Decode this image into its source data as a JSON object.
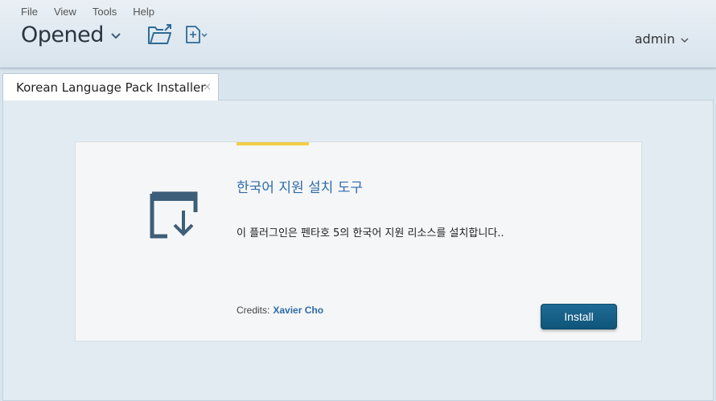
{
  "menu": {
    "items": [
      "File",
      "View",
      "Tools",
      "Help"
    ]
  },
  "perspective": {
    "label": "Opened",
    "icon": "chevron-down-icon"
  },
  "toolbar": {
    "open_icon": "folder-open-icon",
    "new_icon": "new-file-icon"
  },
  "user": {
    "name": "admin",
    "icon": "chevron-down-icon"
  },
  "tab": {
    "label": "Korean Language Pack Installer",
    "close": "×"
  },
  "plugin": {
    "title": "한국어 지원 설치 도구",
    "description": "이 플러그인은 펜타호 5의 한국어 지원 리소스를 설치합니다..",
    "credits_label": "Credits:",
    "author": "Xavier Cho",
    "install_label": "Install",
    "icon": "download-box-icon"
  },
  "colors": {
    "accent": "#f0ce4a",
    "link": "#2e6ba8",
    "button": "#1a6289",
    "icon": "#3d5e78"
  }
}
